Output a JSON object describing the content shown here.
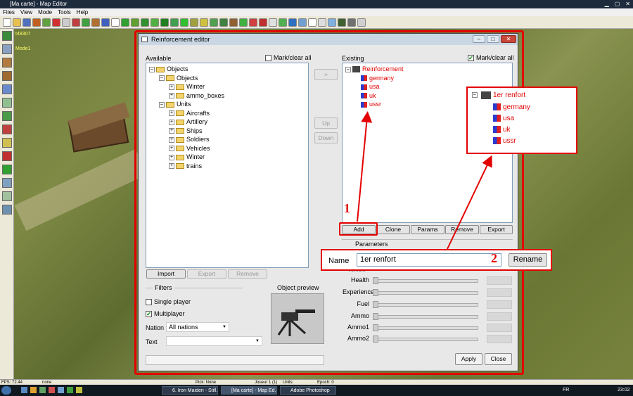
{
  "window": {
    "title": "[Ma carte] - Map Editor"
  },
  "menu": [
    "Files",
    "View",
    "Mode",
    "Tools",
    "Help"
  ],
  "map_info": {
    "coord": "t48307",
    "mode": "Mode1"
  },
  "dialog": {
    "title": "Reinforcement editor",
    "available": {
      "label": "Available",
      "mark_label": "Mark/clear all",
      "tree": [
        {
          "label": "Objects",
          "level": 0,
          "exp": "-"
        },
        {
          "label": "Objects",
          "level": 1,
          "exp": "-"
        },
        {
          "label": "Winter",
          "level": 2,
          "exp": "+"
        },
        {
          "label": "ammo_boxes",
          "level": 2,
          "exp": "+"
        },
        {
          "label": "Units",
          "level": 1,
          "exp": "-"
        },
        {
          "label": "Aircrafts",
          "level": 2,
          "exp": "+"
        },
        {
          "label": "Artillery",
          "level": 2,
          "exp": "+"
        },
        {
          "label": "Ships",
          "level": 2,
          "exp": "+"
        },
        {
          "label": "Soldiers",
          "level": 2,
          "exp": "+"
        },
        {
          "label": "Vehicles",
          "level": 2,
          "exp": "+"
        },
        {
          "label": "Winter",
          "level": 2,
          "exp": "+"
        },
        {
          "label": "trains",
          "level": 2,
          "exp": "+"
        }
      ],
      "import": "Import",
      "export": "Export",
      "remove": "Remove"
    },
    "arrows": {
      "move": ">",
      "up": "Up",
      "down": "Down"
    },
    "existing": {
      "label": "Existing",
      "mark_label": "Mark/clear all",
      "root": "Reinforcement",
      "items": [
        "germany",
        "usa",
        "uk",
        "ussr"
      ],
      "add": "Add",
      "clone": "Clone",
      "params": "Params",
      "remove": "Remove",
      "export": "Export"
    },
    "filters": {
      "label": "Filters",
      "single": "Single player",
      "multi": "Multiplayer",
      "nation_label": "Nation",
      "nation_value": "All nations",
      "text_label": "Text"
    },
    "preview": {
      "label": "Object preview"
    },
    "parameters": {
      "label": "Parameters",
      "partial": "Vehicle",
      "rows": [
        "Health",
        "Experience",
        "Fuel",
        "Ammo",
        "Ammo1",
        "Ammo2"
      ]
    },
    "apply": "Apply",
    "close": "Close"
  },
  "callout_tree": {
    "root": "1er renfort",
    "items": [
      "germany",
      "usa",
      "uk",
      "ussr"
    ]
  },
  "callout_name": {
    "label": "Name",
    "value": "1er renfort",
    "button": "Rename"
  },
  "markers": {
    "one": "1",
    "two": "2"
  },
  "status": {
    "fps": "FPS: 72.44",
    "none": "none",
    "pick": "Pick: None",
    "player": "Joueur 1 (1)",
    "units": "Units:",
    "epoch": "Epoch: 0"
  },
  "taskbar": {
    "tasks": [
      "6. Iron Maiden - Still...",
      "[Ma carte] - Map Ed...",
      "Adobe Photoshop"
    ],
    "lang": "FR",
    "time": "23:02"
  },
  "colors": {
    "red": "#e30000",
    "panel_border": "#7f9db9"
  }
}
